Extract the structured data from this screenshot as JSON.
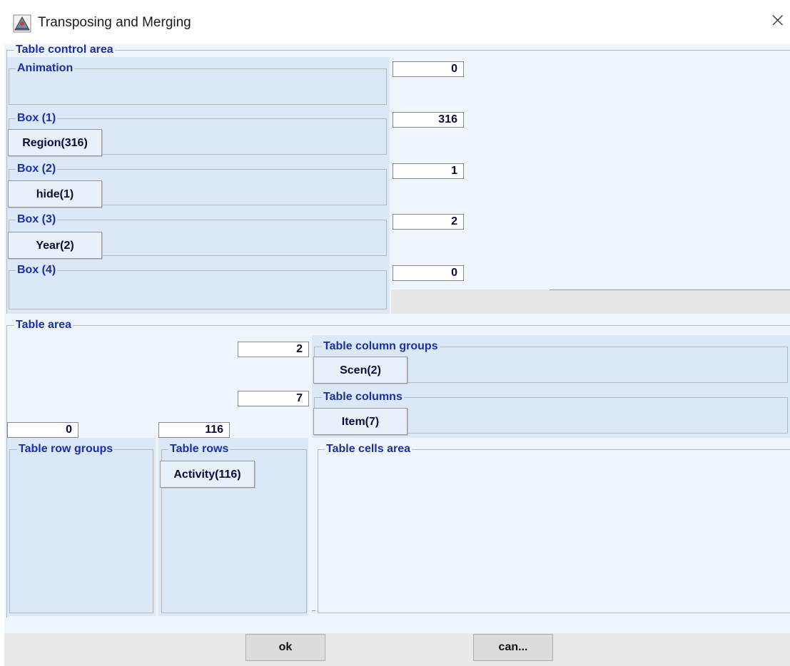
{
  "window": {
    "title": "Transposing and Merging",
    "app_icon": "java-app-icon",
    "close_icon": "close-icon"
  },
  "table_control_area": {
    "label": "Table control area",
    "animation": {
      "label": "Animation",
      "count": "0"
    },
    "box1": {
      "label": "Box (1)",
      "count": "316",
      "chip": "Region(316)"
    },
    "box2": {
      "label": "Box (2)",
      "count": "1",
      "chip": "hide(1)"
    },
    "box3": {
      "label": "Box (3)",
      "count": "2",
      "chip": "Year(2)"
    },
    "box4": {
      "label": "Box (4)",
      "count": "0"
    }
  },
  "table_area": {
    "label": "Table area",
    "column_groups": {
      "label": "Table column groups",
      "count": "2",
      "chip": "Scen(2)"
    },
    "columns": {
      "label": "Table columns",
      "count": "7",
      "chip": "Item(7)"
    },
    "row_groups": {
      "label": "Table row groups",
      "count": "0"
    },
    "rows": {
      "label": "Table rows",
      "count": "116",
      "chip": "Activity(116)"
    },
    "cells": {
      "label": "Table cells area"
    }
  },
  "buttons": {
    "ok": "ok",
    "cancel": "can..."
  },
  "colors": {
    "label": "#1c2ea8",
    "panel": "#dae8f7",
    "background": "#eef5fc"
  }
}
